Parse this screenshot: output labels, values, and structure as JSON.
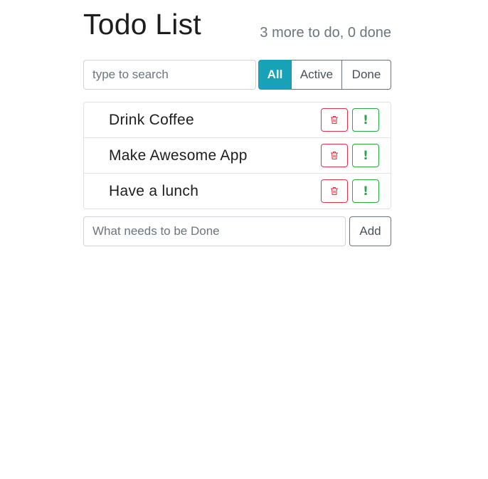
{
  "header": {
    "title": "Todo List",
    "counter": "3 more to do, 0 done"
  },
  "search": {
    "placeholder": "type to search",
    "value": ""
  },
  "filters": [
    {
      "label": "All",
      "active": true
    },
    {
      "label": "Active",
      "active": false
    },
    {
      "label": "Done",
      "active": false
    }
  ],
  "todos": [
    {
      "label": "Drink Coffee",
      "delete_icon": "trash-icon",
      "important_icon": "exclamation-icon"
    },
    {
      "label": "Make Awesome App",
      "delete_icon": "trash-icon",
      "important_icon": "exclamation-icon"
    },
    {
      "label": "Have a lunch",
      "delete_icon": "trash-icon",
      "important_icon": "exclamation-icon"
    }
  ],
  "important_glyph": "!",
  "add_form": {
    "placeholder": "What needs to be Done",
    "value": "",
    "button_label": "Add"
  },
  "colors": {
    "accent": "#17a2b8",
    "danger": "#dc3545",
    "success": "#28a745",
    "muted": "#6c757d"
  }
}
